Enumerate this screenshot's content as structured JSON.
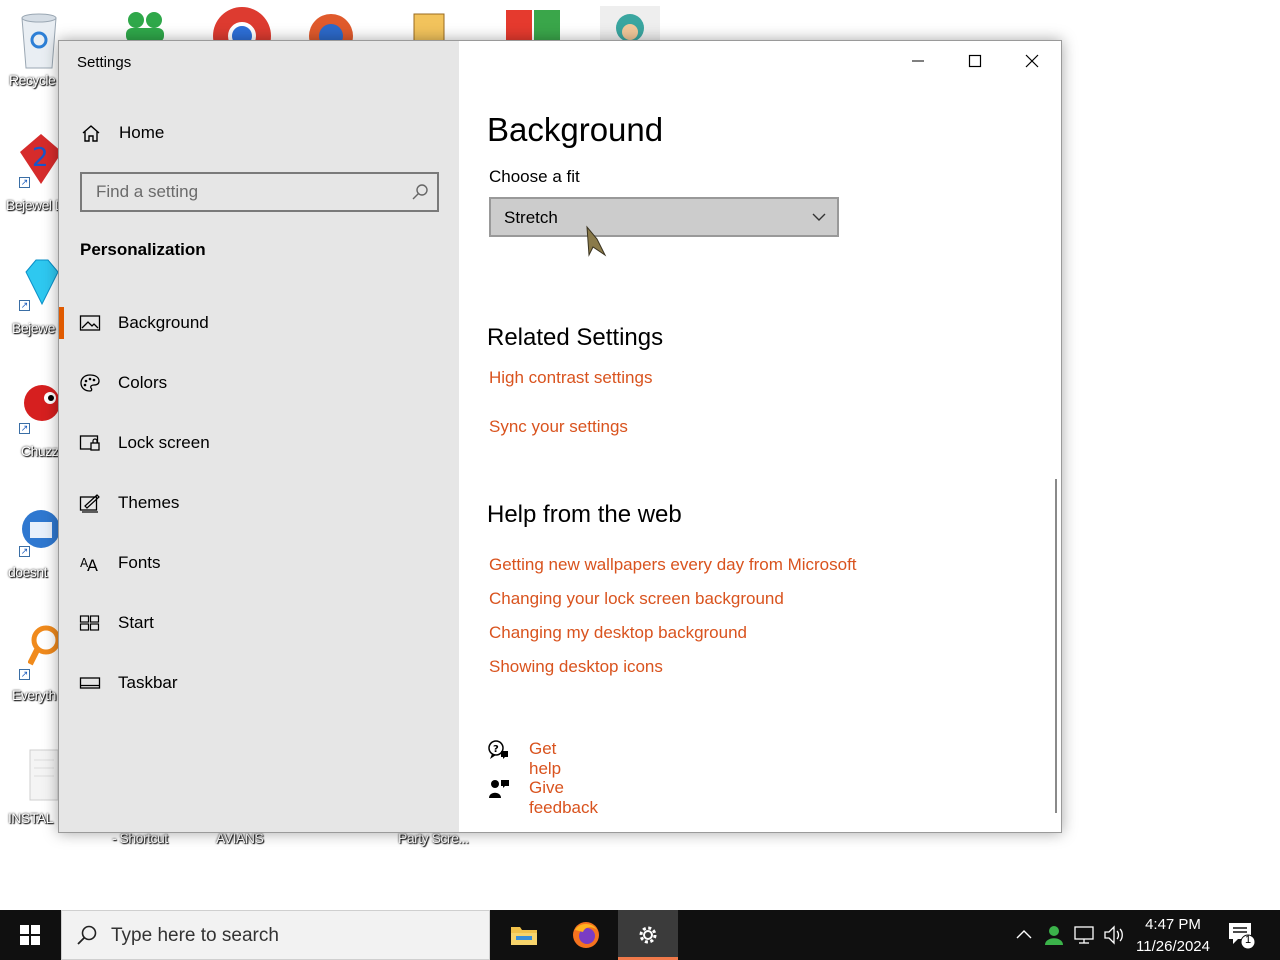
{
  "desktop": {
    "icons": [
      {
        "label": "Recycle",
        "name": "recycle-bin"
      },
      {
        "label": "Bejewel Delux",
        "name": "bejeweled-2"
      },
      {
        "label": "Bejewe Delux",
        "name": "bejeweled"
      },
      {
        "label": "Chuzz Delux",
        "name": "chuzzle"
      },
      {
        "label": "doesnt",
        "name": "thunderbird-like"
      },
      {
        "label": "Everyth",
        "name": "everything"
      },
      {
        "label": "INSTAL",
        "name": "install-doc"
      }
    ],
    "bottom_labels": [
      "- Shortcut",
      "AVIANS",
      "Party Scre..."
    ]
  },
  "window": {
    "title": "Settings",
    "controls": {
      "minimize": "minimize",
      "maximize": "maximize",
      "close": "close"
    }
  },
  "sidebar": {
    "home_label": "Home",
    "search_placeholder": "Find a setting",
    "section_title": "Personalization",
    "items": [
      {
        "label": "Background",
        "icon": "image-icon",
        "active": true
      },
      {
        "label": "Colors",
        "icon": "palette-icon",
        "active": false
      },
      {
        "label": "Lock screen",
        "icon": "lock-screen-icon",
        "active": false
      },
      {
        "label": "Themes",
        "icon": "themes-icon",
        "active": false
      },
      {
        "label": "Fonts",
        "icon": "fonts-icon",
        "active": false
      },
      {
        "label": "Start",
        "icon": "start-icon",
        "active": false
      },
      {
        "label": "Taskbar",
        "icon": "taskbar-icon",
        "active": false
      }
    ]
  },
  "main": {
    "heading": "Background",
    "fit_label": "Choose a fit",
    "fit_value": "Stretch",
    "related_title": "Related Settings",
    "related_links": [
      "High contrast settings",
      "Sync your settings"
    ],
    "help_title": "Help from the web",
    "help_links": [
      "Getting new wallpapers every day from Microsoft",
      "Changing your lock screen background",
      "Changing my desktop background",
      "Showing desktop icons"
    ],
    "get_help": "Get help",
    "give_feedback": "Give feedback"
  },
  "taskbar": {
    "search_placeholder": "Type here to search",
    "time": "4:47 PM",
    "date": "11/26/2024",
    "notification_count": "1"
  },
  "colors": {
    "accent": "#d9531e",
    "sidebar_bg": "#e6e6e6",
    "taskbar_bg": "#101010"
  }
}
